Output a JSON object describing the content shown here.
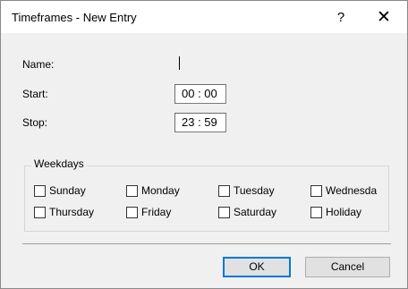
{
  "window": {
    "title": "Timeframes - New Entry",
    "help_label": "?",
    "close_label": "✕"
  },
  "form": {
    "name_label": "Name:",
    "name_value": "",
    "start_label": "Start:",
    "start_value": "00 : 00",
    "stop_label": "Stop:",
    "stop_value": "23 : 59"
  },
  "weekdays": {
    "title": "Weekdays",
    "days": [
      {
        "label": "Sunday",
        "checked": false
      },
      {
        "label": "Monday",
        "checked": false
      },
      {
        "label": "Tuesday",
        "checked": false
      },
      {
        "label": "Wednesda",
        "checked": false
      },
      {
        "label": "Thursday",
        "checked": false
      },
      {
        "label": "Friday",
        "checked": false
      },
      {
        "label": "Saturday",
        "checked": false
      },
      {
        "label": "Holiday",
        "checked": false
      }
    ]
  },
  "buttons": {
    "ok_label": "OK",
    "cancel_label": "Cancel"
  }
}
